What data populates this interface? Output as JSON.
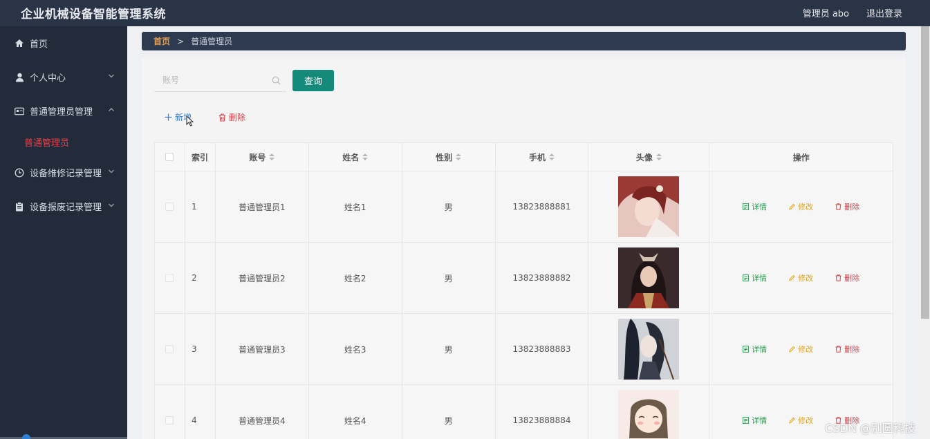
{
  "app": {
    "title": "企业机械设备智能管理系统",
    "user": "管理员 abo",
    "logout": "退出登录"
  },
  "sidebar": {
    "items": [
      {
        "label": "首页",
        "icon": "home-icon"
      },
      {
        "label": "个人中心",
        "icon": "user-icon"
      },
      {
        "label": "普通管理员管理",
        "icon": "id-card-icon"
      },
      {
        "label": "设备维修记录管理",
        "icon": "clock-icon"
      },
      {
        "label": "设备报废记录管理",
        "icon": "clipboard-icon"
      }
    ],
    "submenu": {
      "active_label": "普通管理员"
    }
  },
  "breadcrumb": {
    "home": "首页",
    "separator": ">",
    "current": "普通管理员"
  },
  "search": {
    "placeholder": "账号",
    "button": "查询"
  },
  "toolbar": {
    "add": "新增",
    "delete": "删除"
  },
  "table": {
    "headers": {
      "index": "索引",
      "account": "账号",
      "name": "姓名",
      "gender": "性别",
      "phone": "手机",
      "avatar": "头像",
      "ops": "操作"
    },
    "rows": [
      {
        "index": "1",
        "account": "普通管理员1",
        "name": "姓名1",
        "gender": "男",
        "phone": "13823888881"
      },
      {
        "index": "2",
        "account": "普通管理员2",
        "name": "姓名2",
        "gender": "男",
        "phone": "13823888882"
      },
      {
        "index": "3",
        "account": "普通管理员3",
        "name": "姓名3",
        "gender": "男",
        "phone": "13823888883"
      },
      {
        "index": "4",
        "account": "普通管理员4",
        "name": "姓名4",
        "gender": "男",
        "phone": "13823888884"
      }
    ],
    "actions": {
      "detail": "详情",
      "edit": "修改",
      "delete": "删除"
    }
  },
  "watermark": "CSDN @别圆科技",
  "colors": {
    "topbar": "#2a3447",
    "sidebar": "#232b3b",
    "active_menu": "#e6434b",
    "query_button": "#168a7a",
    "detail": "#2e9a52",
    "edit": "#e1a41c",
    "danger": "#d6434b"
  }
}
